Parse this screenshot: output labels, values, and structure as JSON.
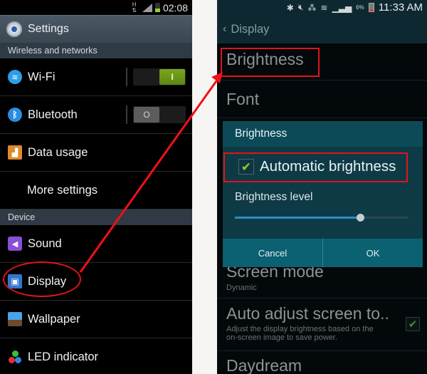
{
  "left_phone": {
    "statusbar": {
      "network_type": "H",
      "time": "02:08"
    },
    "appbar": {
      "title": "Settings",
      "icon": "gear-icon"
    },
    "sections": [
      {
        "header": "Wireless and networks",
        "items": [
          {
            "label": "Wi-Fi",
            "icon": "wifi-icon",
            "toggle": "on",
            "toggle_glyph": "I"
          },
          {
            "label": "Bluetooth",
            "icon": "bluetooth-icon",
            "toggle": "off",
            "toggle_glyph": "O"
          },
          {
            "label": "Data usage",
            "icon": "data-usage-icon"
          },
          {
            "label": "More settings"
          }
        ]
      },
      {
        "header": "Device",
        "items": [
          {
            "label": "Sound",
            "icon": "sound-icon"
          },
          {
            "label": "Display",
            "icon": "display-icon",
            "annotated": true
          },
          {
            "label": "Wallpaper",
            "icon": "wallpaper-icon"
          },
          {
            "label": "LED indicator",
            "icon": "led-indicator-icon"
          }
        ]
      }
    ]
  },
  "right_phone": {
    "statusbar": {
      "battery": "6%",
      "time": "11:33 AM",
      "icons": [
        "bluetooth-icon",
        "mute-icon",
        "nfc-icon",
        "wifi-icon",
        "signal-icon",
        "battery-icon"
      ]
    },
    "appbar": {
      "back_glyph": "‹",
      "title": "Display"
    },
    "items": [
      {
        "title": "Brightness",
        "annotated": true
      },
      {
        "title": "Font"
      },
      {
        "title": "Screen mode",
        "subtitle": "Dynamic"
      },
      {
        "title": "Auto adjust screen to..",
        "subtitle_line1": "Adjust the display brightness based on the",
        "subtitle_line2": "on-screen image to save power.",
        "checked": true
      },
      {
        "title": "Daydream"
      }
    ],
    "dialog": {
      "title": "Brightness",
      "auto_brightness_label": "Automatic brightness",
      "auto_brightness_checked": true,
      "level_label": "Brightness level",
      "level_value": 0.72,
      "cancel_label": "Cancel",
      "ok_label": "OK"
    }
  },
  "glyphs": {
    "check": "✔",
    "wifi": "≋",
    "bluetooth": "ᛒ",
    "data": "▟",
    "sound": "◀",
    "display": "▣"
  },
  "annotation_color": "#e0141a"
}
